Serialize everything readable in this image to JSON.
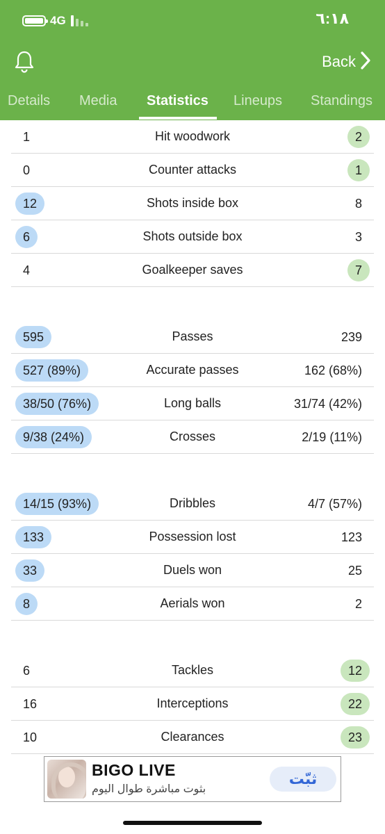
{
  "status_bar": {
    "network": "4G",
    "time": "٦:١٨",
    "icons": [
      "battery-icon",
      "signal-icon"
    ]
  },
  "header": {
    "back_label": "Back",
    "icons": [
      "bell-icon",
      "chevron-right-icon"
    ]
  },
  "tabs": [
    {
      "label": "Details",
      "active": false
    },
    {
      "label": "Media",
      "active": false
    },
    {
      "label": "Statistics",
      "active": true
    },
    {
      "label": "Lineups",
      "active": false
    },
    {
      "label": "Standings",
      "active": false
    }
  ],
  "colors": {
    "header_green": "#6bb24a",
    "highlight_blue": "#bcdaf6",
    "highlight_green": "#c9e6bd"
  },
  "stats": [
    {
      "label": "Hit woodwork",
      "home": "1",
      "away": "2",
      "highlight": "away"
    },
    {
      "label": "Counter attacks",
      "home": "0",
      "away": "1",
      "highlight": "away"
    },
    {
      "label": "Shots inside box",
      "home": "12",
      "away": "8",
      "highlight": "home"
    },
    {
      "label": "Shots outside box",
      "home": "6",
      "away": "3",
      "highlight": "home"
    },
    {
      "label": "Goalkeeper saves",
      "home": "4",
      "away": "7",
      "highlight": "away"
    },
    {
      "label": "Passes",
      "home": "595",
      "away": "239",
      "highlight": "home"
    },
    {
      "label": "Accurate passes",
      "home": "527 (89%)",
      "away": "162 (68%)",
      "highlight": "home"
    },
    {
      "label": "Long balls",
      "home": "38/50 (76%)",
      "away": "31/74 (42%)",
      "highlight": "home"
    },
    {
      "label": "Crosses",
      "home": "9/38 (24%)",
      "away": "2/19 (11%)",
      "highlight": "home"
    },
    {
      "label": "Dribbles",
      "home": "14/15 (93%)",
      "away": "4/7 (57%)",
      "highlight": "home"
    },
    {
      "label": "Possession lost",
      "home": "133",
      "away": "123",
      "highlight": "home"
    },
    {
      "label": "Duels won",
      "home": "33",
      "away": "25",
      "highlight": "home"
    },
    {
      "label": "Aerials won",
      "home": "8",
      "away": "2",
      "highlight": "home"
    },
    {
      "label": "Tackles",
      "home": "6",
      "away": "12",
      "highlight": "away"
    },
    {
      "label": "Interceptions",
      "home": "16",
      "away": "22",
      "highlight": "away"
    },
    {
      "label": "Clearances",
      "home": "10",
      "away": "23",
      "highlight": "away"
    }
  ],
  "ad": {
    "title": "BIGO LIVE",
    "subtitle": "بثوت مباشرة طوال اليوم",
    "button": "ثبّت"
  }
}
